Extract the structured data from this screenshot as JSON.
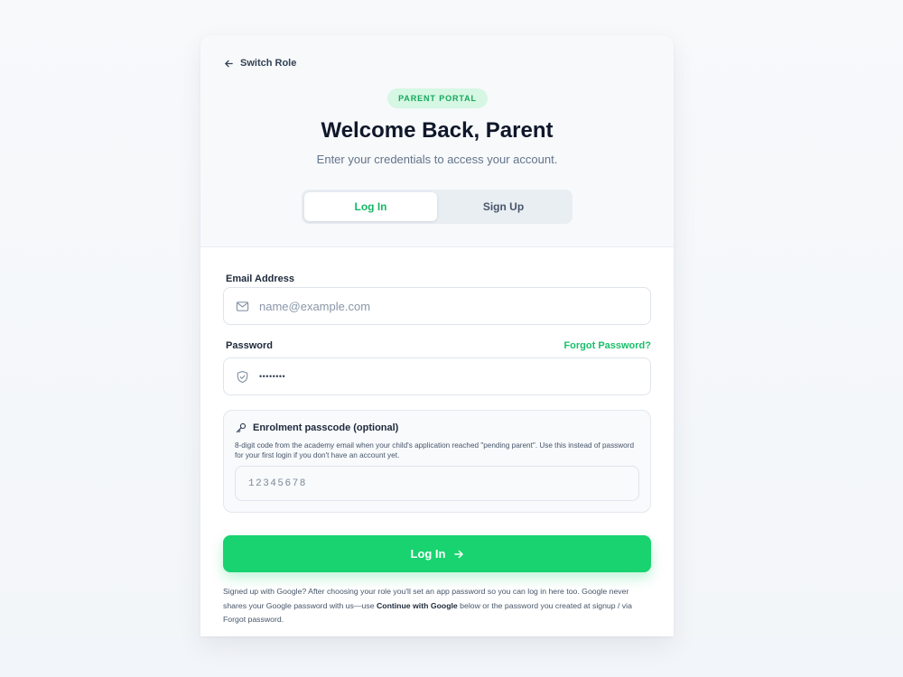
{
  "header": {
    "back_label": "Switch Role",
    "badge": "PARENT PORTAL",
    "title": "Welcome Back, Parent",
    "subtitle": "Enter your credentials to access your account."
  },
  "tabs": [
    {
      "label": "Log In",
      "active": true
    },
    {
      "label": "Sign Up",
      "active": false
    }
  ],
  "form": {
    "email": {
      "label": "Email Address",
      "placeholder": "name@example.com",
      "value": ""
    },
    "password": {
      "label": "Password",
      "forgot_label": "Forgot Password?",
      "masked_value": "••••••••"
    },
    "passcode": {
      "title": "Enrolment passcode (optional)",
      "help": "8-digit code from the academy email when your child's application reached \"pending parent\". Use this instead of password for your first login if you don't have an account yet.",
      "placeholder": "12345678"
    },
    "submit_label": "Log In"
  },
  "note": {
    "part1": "Signed up with Google? After choosing your role you'll set an app password so you can log in here too. Google never shares your Google password with us—use ",
    "bold": "Continue with Google",
    "part2": " below or the password you created at signup / via Forgot password."
  },
  "colors": {
    "accent": "#18d36f",
    "accent_text": "#16b865",
    "badge_bg": "#d6f7e4",
    "title": "#0f172a"
  },
  "icons": {
    "back": "arrow-left-icon",
    "email": "mail-icon",
    "password": "shield-check-icon",
    "passcode": "key-icon",
    "submit": "arrow-right-icon"
  }
}
